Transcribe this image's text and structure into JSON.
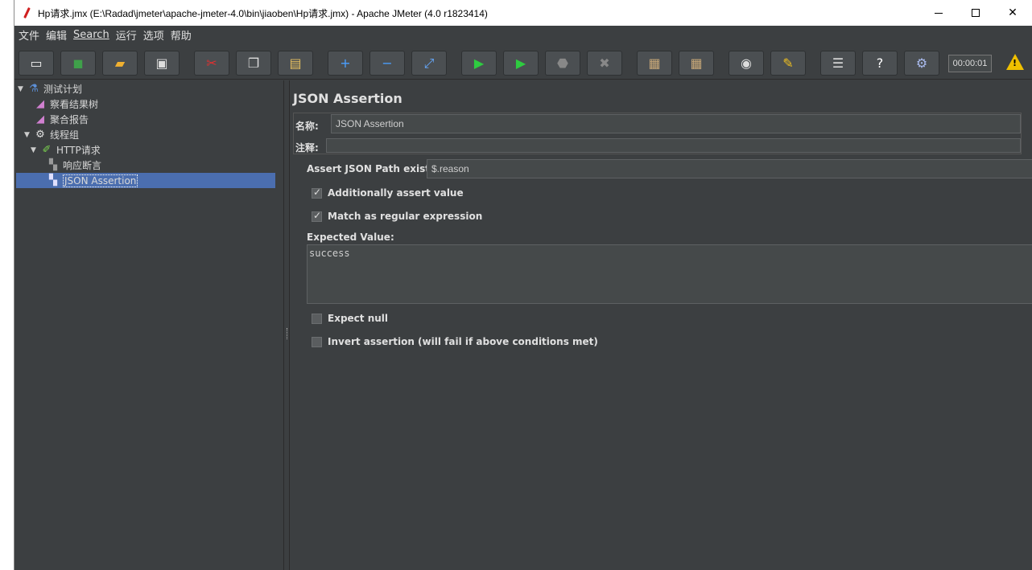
{
  "window": {
    "title": "Hp请求.jmx (E:\\Radad\\jmeter\\apache-jmeter-4.0\\bin\\jiaoben\\Hp请求.jmx) - Apache JMeter (4.0 r1823414)",
    "close_glyph": "✕"
  },
  "menu": {
    "items": [
      "文件",
      "编辑",
      "Search",
      "运行",
      "选项",
      "帮助"
    ]
  },
  "toolbar": {
    "timer": "00:00:01",
    "warning_glyph": "!",
    "buttons": [
      {
        "name": "new-icon",
        "glyph": "▭",
        "color": "#f2f2f2"
      },
      {
        "name": "templates-icon",
        "glyph": "◼",
        "color": "#3fa04a"
      },
      {
        "name": "open-icon",
        "glyph": "▰",
        "color": "#f0b030"
      },
      {
        "name": "save-icon",
        "glyph": "▣",
        "color": "#dddddd"
      },
      {
        "name": "cut-icon",
        "glyph": "✂",
        "color": "#e03030"
      },
      {
        "name": "copy-icon",
        "glyph": "❐",
        "color": "#dddddd"
      },
      {
        "name": "paste-icon",
        "glyph": "▤",
        "color": "#e8c060"
      },
      {
        "name": "expand-icon",
        "glyph": "+",
        "color": "#4aa0ff"
      },
      {
        "name": "collapse-icon",
        "glyph": "−",
        "color": "#4aa0ff"
      },
      {
        "name": "toggle-icon",
        "glyph": "⤢",
        "color": "#66aaff"
      },
      {
        "name": "start-icon",
        "glyph": "▶",
        "color": "#2ecc40"
      },
      {
        "name": "start-no-pauses-icon",
        "glyph": "▶",
        "color": "#2ecc40"
      },
      {
        "name": "stop-icon",
        "glyph": "⬣",
        "color": "#888888"
      },
      {
        "name": "shutdown-icon",
        "glyph": "✖",
        "color": "#888888"
      },
      {
        "name": "clear-icon",
        "glyph": "▦",
        "color": "#c8a878"
      },
      {
        "name": "clear-all-icon",
        "glyph": "▦",
        "color": "#c8a878"
      },
      {
        "name": "search-icon",
        "glyph": "◉",
        "color": "#dddddd"
      },
      {
        "name": "reset-search-icon",
        "glyph": "✎",
        "color": "#f0c020"
      },
      {
        "name": "function-helper-icon",
        "glyph": "☰",
        "color": "#dddddd"
      },
      {
        "name": "help-icon",
        "glyph": "?",
        "color": "#ffffff"
      },
      {
        "name": "remote-icon",
        "glyph": "⚙",
        "color": "#aabbee"
      }
    ]
  },
  "tree": {
    "nodes": [
      {
        "label": "测试计划",
        "icon": "flask-icon",
        "glyph": "⚗",
        "color": "#5c8fd6",
        "arrow": "▼"
      },
      {
        "label": "察看结果树",
        "icon": "graph-icon",
        "glyph": "◢",
        "color": "#d080d0",
        "arrow": ""
      },
      {
        "label": "聚合报告",
        "icon": "graph-icon",
        "glyph": "◢",
        "color": "#d080d0",
        "arrow": ""
      },
      {
        "label": "线程组",
        "icon": "gear-icon",
        "glyph": "⚙",
        "color": "#e0e0e0",
        "arrow": "▼"
      },
      {
        "label": "HTTP请求",
        "icon": "pipette-icon",
        "glyph": "✐",
        "color": "#7bd34f",
        "arrow": "▼"
      },
      {
        "label": "响应断言",
        "icon": "assertion-icon",
        "glyph": "▚",
        "color": "#9a9a9a",
        "arrow": ""
      },
      {
        "label": "JSON Assertion",
        "icon": "assertion-icon",
        "glyph": "▚",
        "color": "#e0e0ff",
        "arrow": ""
      }
    ]
  },
  "panel": {
    "title": "JSON Assertion",
    "name_label": "名称:",
    "name_value": "JSON Assertion",
    "comment_label": "注释:",
    "comment_value": "",
    "path_label": "Assert JSON Path exists:",
    "path_value": "$.reason",
    "additionally_label": "Additionally assert value",
    "additionally_checked": true,
    "regex_label": "Match as regular expression",
    "regex_checked": true,
    "expected_label": "Expected Value:",
    "expected_value": "success",
    "expect_null_label": "Expect null",
    "expect_null_checked": false,
    "invert_label": "Invert assertion (will fail if above conditions met)",
    "invert_checked": false
  }
}
